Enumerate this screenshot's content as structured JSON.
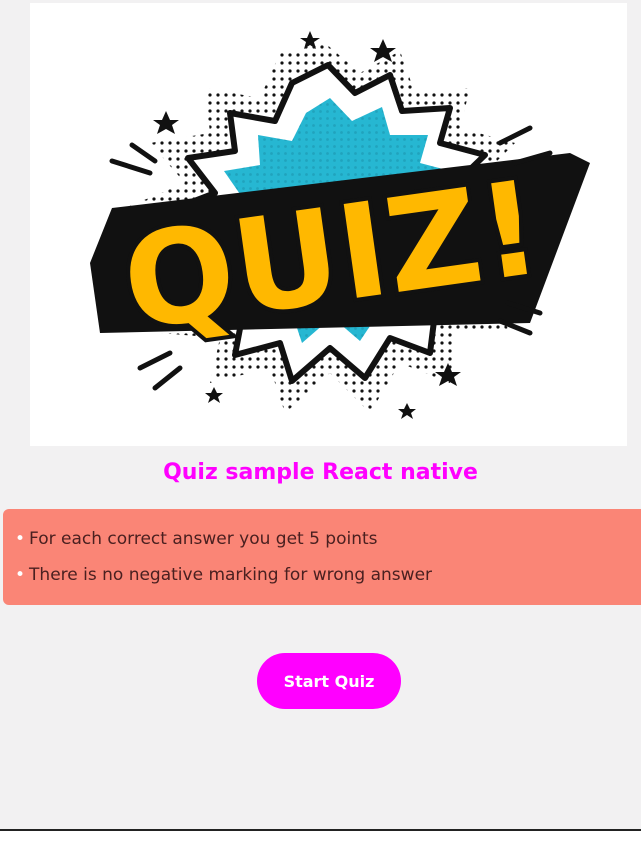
{
  "hero": {
    "logo_text": "QUIZ!",
    "colors": {
      "text": "#ffb800",
      "burst": "#26b7d2",
      "outline": "#111111"
    }
  },
  "title": "Quiz sample React native",
  "rules": [
    {
      "bullet": "•",
      "text": "For each correct answer you get 5 points"
    },
    {
      "bullet": "•",
      "text": "There is no negative marking for wrong answer"
    }
  ],
  "start_button": {
    "label": "Start Quiz"
  },
  "colors": {
    "accent": "#ff00ff",
    "rules_bg": "#fa8576",
    "page_bg": "#f2f1f2"
  }
}
